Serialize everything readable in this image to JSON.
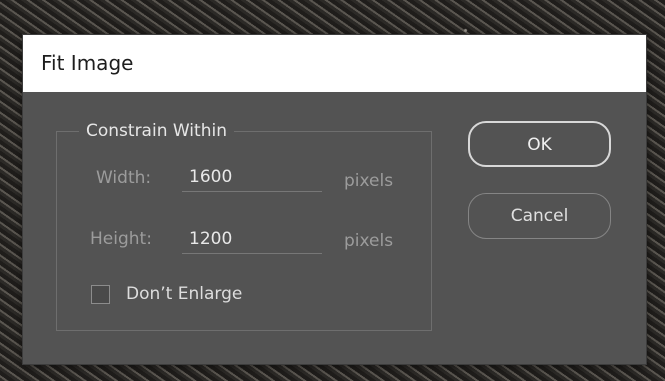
{
  "dialog": {
    "title": "Fit Image"
  },
  "constrain": {
    "legend": "Constrain Within",
    "width": {
      "label": "Width:",
      "value": "1600",
      "unit": "pixels"
    },
    "height": {
      "label": "Height:",
      "value": "1200",
      "unit": "pixels"
    },
    "dont_enlarge": {
      "label": "Don’t Enlarge",
      "checked": false
    }
  },
  "buttons": {
    "ok_label": "OK",
    "cancel_label": "Cancel"
  },
  "colors": {
    "dialog_bg": "#535353",
    "titlebar_bg": "#ffffff"
  }
}
